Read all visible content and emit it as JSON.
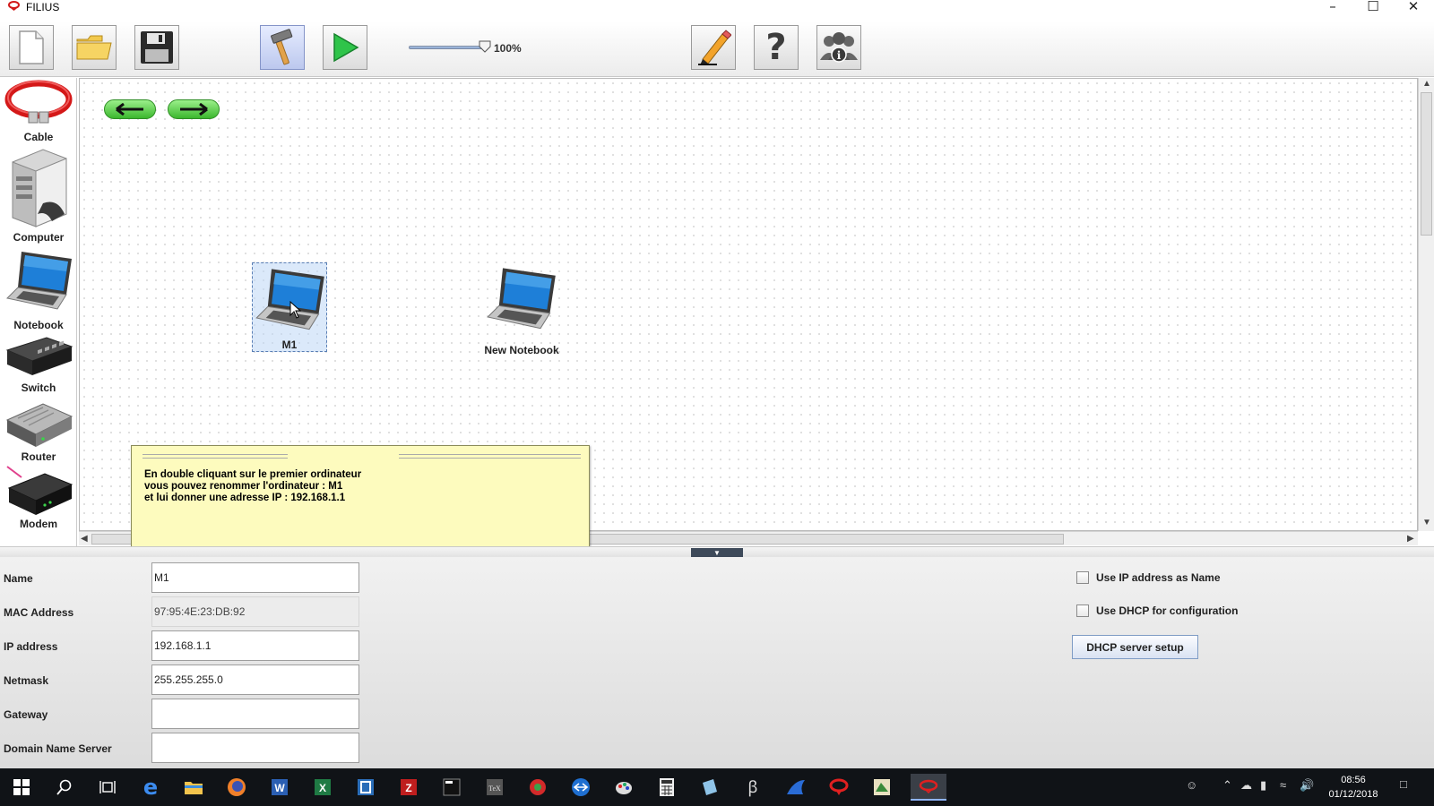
{
  "window": {
    "title": "FILIUS"
  },
  "toolbar": {
    "zoom_label": "100%",
    "zoom_level_percent": 100,
    "buttons": [
      "new-file",
      "open-folder",
      "save",
      "design-mode",
      "simulation-mode",
      "edit",
      "help",
      "about"
    ]
  },
  "palette": {
    "items": [
      {
        "id": "cable",
        "label": "Cable"
      },
      {
        "id": "computer",
        "label": "Computer"
      },
      {
        "id": "notebook",
        "label": "Notebook"
      },
      {
        "id": "switch",
        "label": "Switch"
      },
      {
        "id": "router",
        "label": "Router"
      },
      {
        "id": "modem",
        "label": "Modem"
      }
    ]
  },
  "canvas": {
    "nodes": [
      {
        "id": "m1",
        "label": "M1",
        "selected": true
      },
      {
        "id": "new-notebook",
        "label": "New Notebook",
        "selected": false
      }
    ],
    "note": {
      "text": "En double cliquant sur le premier ordinateur\nvous pouvez renommer l'ordinateur : M1\net lui donner une adresse IP : 192.168.1.1"
    }
  },
  "config": {
    "fields": {
      "name": {
        "label": "Name",
        "value": "M1"
      },
      "mac": {
        "label": "MAC Address",
        "value": "97:95:4E:23:DB:92"
      },
      "ip": {
        "label": "IP address",
        "value": "192.168.1.1"
      },
      "netmask": {
        "label": "Netmask",
        "value": "255.255.255.0"
      },
      "gateway": {
        "label": "Gateway",
        "value": ""
      },
      "dns": {
        "label": "Domain Name Server",
        "value": ""
      }
    },
    "use_ip_as_name": {
      "label": "Use IP address as Name",
      "checked": false
    },
    "use_dhcp": {
      "label": "Use DHCP for configuration",
      "checked": false
    },
    "dhcp_button": "DHCP server setup"
  },
  "taskbar": {
    "time": "08:56",
    "date": "01/12/2018"
  },
  "colors": {
    "note_background": "#fdfbbe",
    "nav_button_green": "#3cb72e",
    "taskbar": "#101317"
  }
}
